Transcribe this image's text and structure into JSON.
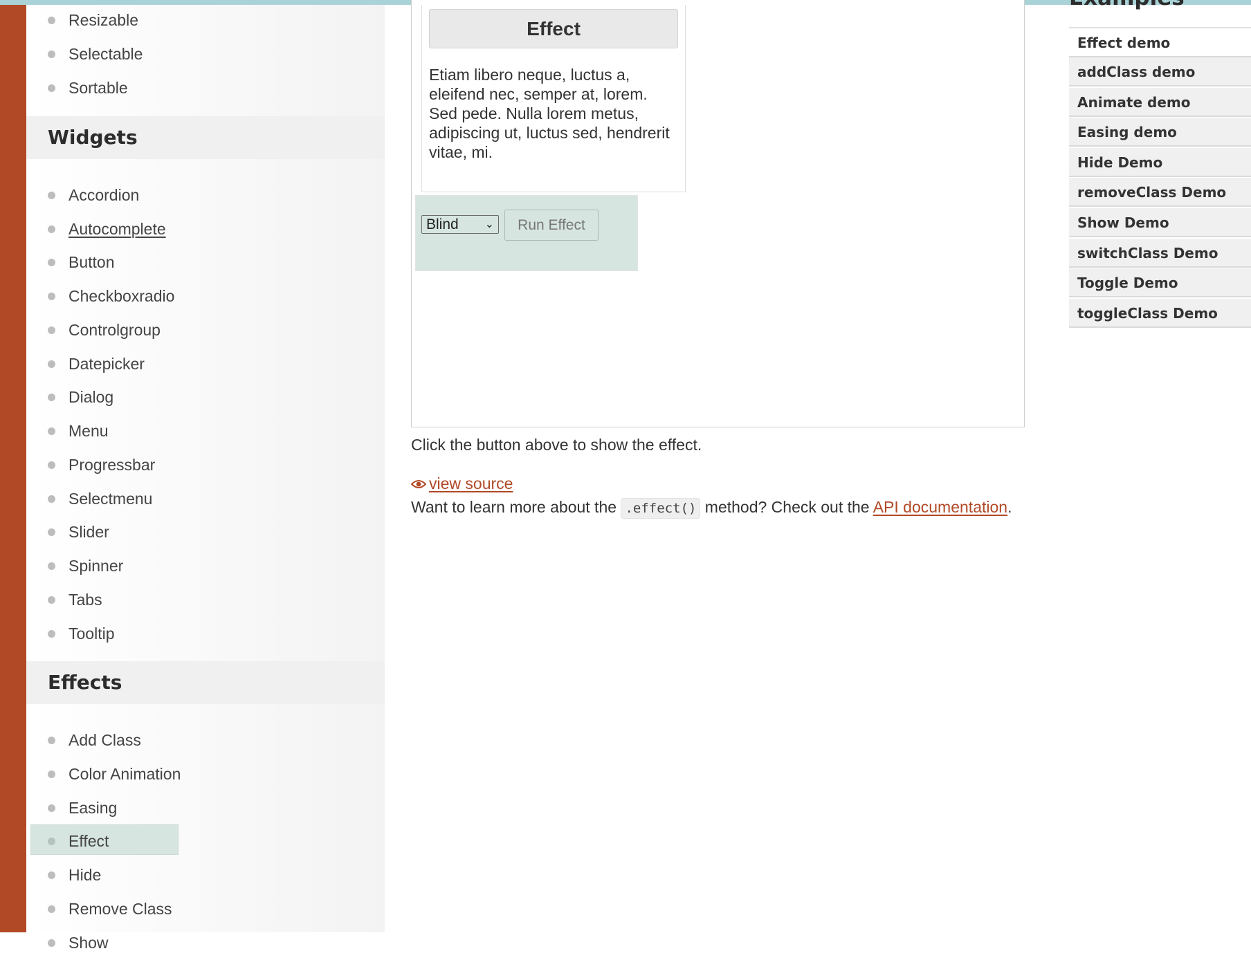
{
  "sidebar": {
    "interactions_tail": [
      "Resizable",
      "Selectable",
      "Sortable"
    ],
    "widgets_heading": "Widgets",
    "widgets": [
      "Accordion",
      "Autocomplete",
      "Button",
      "Checkboxradio",
      "Controlgroup",
      "Datepicker",
      "Dialog",
      "Menu",
      "Progressbar",
      "Selectmenu",
      "Slider",
      "Spinner",
      "Tabs",
      "Tooltip"
    ],
    "effects_heading": "Effects",
    "effects": [
      "Add Class",
      "Color Animation",
      "Easing",
      "Effect",
      "Hide",
      "Remove Class",
      "Show"
    ],
    "active_item": "Effect",
    "hovered_item": "Autocomplete"
  },
  "demo": {
    "header": "Effect",
    "body_text": "Etiam libero neque, luctus a, eleifend nec, semper at, lorem. Sed pede. Nulla lorem metus, adipiscing ut, luctus sed, hendrerit vitae, mi.",
    "select_value": "Blind",
    "run_button": "Run Effect"
  },
  "description": "Click the button above to show the effect.",
  "view_source": "view source",
  "learn_more": {
    "before": "Want to learn more about the ",
    "code": ".effect()",
    "middle": " method? Check out the ",
    "link": "API documentation",
    "after": "."
  },
  "examples": {
    "title": "Examples",
    "items": [
      "Effect demo",
      "addClass demo",
      "Animate demo",
      "Easing demo",
      "Hide Demo",
      "removeClass Demo",
      "Show Demo",
      "switchClass Demo",
      "Toggle Demo",
      "toggleClass Demo"
    ]
  },
  "colors": {
    "brand": "#b24926",
    "highlight": "#d6e5df",
    "top_bar": "#a9d3d6"
  }
}
